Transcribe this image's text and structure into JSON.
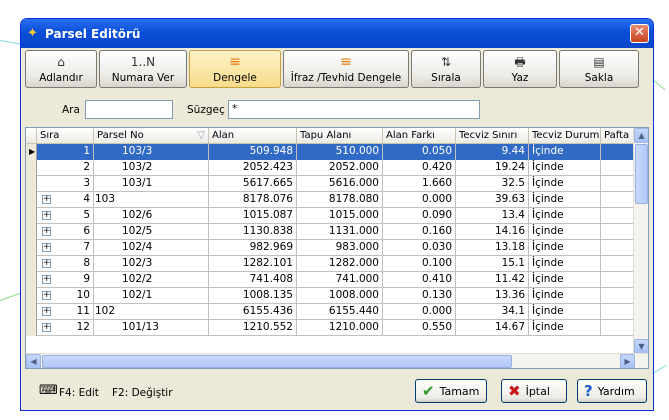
{
  "window": {
    "title": "Parsel Editörü",
    "close": "✕"
  },
  "toolbar": [
    {
      "icon": "tag-icon",
      "glyph": "⌂",
      "label": "Adlandır"
    },
    {
      "icon": "numbering-icon",
      "glyph": "1..N",
      "label": "Numara Ver"
    },
    {
      "icon": "balance-icon",
      "glyph": "≡",
      "label": "Dengele"
    },
    {
      "icon": "split-merge-icon",
      "glyph": "≡",
      "label": "İfraz /Tevhid Dengele"
    },
    {
      "icon": "sort-icon",
      "glyph": "⇅",
      "label": "Sırala"
    },
    {
      "icon": "printer-icon",
      "glyph": "🖶",
      "label": "Yaz"
    },
    {
      "icon": "save-icon",
      "glyph": "▤",
      "label": "Sakla"
    }
  ],
  "filter": {
    "ara_label": "Ara",
    "ara_value": "",
    "suzgec_label": "Süzgeç",
    "suzgec_value": "*"
  },
  "grid": {
    "columns": [
      "Sıra",
      "Parsel No",
      "Alan",
      "Tapu Alanı",
      "Alan Farkı",
      "Tecviz Sınırı",
      "Tecviz Durum",
      "Pafta"
    ],
    "rows": [
      {
        "expand": false,
        "sira": "1",
        "parsel": "103/3",
        "alan": "509.948",
        "tapu": "510.000",
        "fark": "0.050",
        "sinir": "9.44",
        "durum": "İçinde"
      },
      {
        "expand": false,
        "sira": "2",
        "parsel": "103/2",
        "alan": "2052.423",
        "tapu": "2052.000",
        "fark": "0.420",
        "sinir": "19.24",
        "durum": "İçinde"
      },
      {
        "expand": false,
        "sira": "3",
        "parsel": "103/1",
        "alan": "5617.665",
        "tapu": "5616.000",
        "fark": "1.660",
        "sinir": "32.5",
        "durum": "İçinde"
      },
      {
        "expand": true,
        "sira": "4",
        "parsel": "103",
        "alan": "8178.076",
        "tapu": "8178.080",
        "fark": "0.000",
        "sinir": "39.63",
        "durum": "İçinde"
      },
      {
        "expand": true,
        "sira": "5",
        "parsel": "102/6",
        "alan": "1015.087",
        "tapu": "1015.000",
        "fark": "0.090",
        "sinir": "13.4",
        "durum": "İçinde"
      },
      {
        "expand": true,
        "sira": "6",
        "parsel": "102/5",
        "alan": "1130.838",
        "tapu": "1131.000",
        "fark": "0.160",
        "sinir": "14.16",
        "durum": "İçinde"
      },
      {
        "expand": true,
        "sira": "7",
        "parsel": "102/4",
        "alan": "982.969",
        "tapu": "983.000",
        "fark": "0.030",
        "sinir": "13.18",
        "durum": "İçinde"
      },
      {
        "expand": true,
        "sira": "8",
        "parsel": "102/3",
        "alan": "1282.101",
        "tapu": "1282.000",
        "fark": "0.100",
        "sinir": "15.1",
        "durum": "İçinde"
      },
      {
        "expand": true,
        "sira": "9",
        "parsel": "102/2",
        "alan": "741.408",
        "tapu": "741.000",
        "fark": "0.410",
        "sinir": "11.42",
        "durum": "İçinde"
      },
      {
        "expand": true,
        "sira": "10",
        "parsel": "102/1",
        "alan": "1008.135",
        "tapu": "1008.000",
        "fark": "0.130",
        "sinir": "13.36",
        "durum": "İçinde"
      },
      {
        "expand": true,
        "sira": "11",
        "parsel": "102",
        "alan": "6155.436",
        "tapu": "6155.440",
        "fark": "0.000",
        "sinir": "34.1",
        "durum": "İçinde"
      },
      {
        "expand": true,
        "sira": "12",
        "parsel": "101/13",
        "alan": "1210.552",
        "tapu": "1210.000",
        "fark": "0.550",
        "sinir": "14.67",
        "durum": "İçinde"
      }
    ],
    "selected_row": 0
  },
  "footer": {
    "hint_edit": "F4: Edit",
    "hint_change": "F2: Değiştir",
    "ok_label": "Tamam",
    "cancel_label": "İptal",
    "help_label": "Yardım"
  },
  "colors": {
    "title_bar": "#0a4fd8",
    "selection": "#316ac5",
    "dialog_bg": "#ece9d8"
  }
}
